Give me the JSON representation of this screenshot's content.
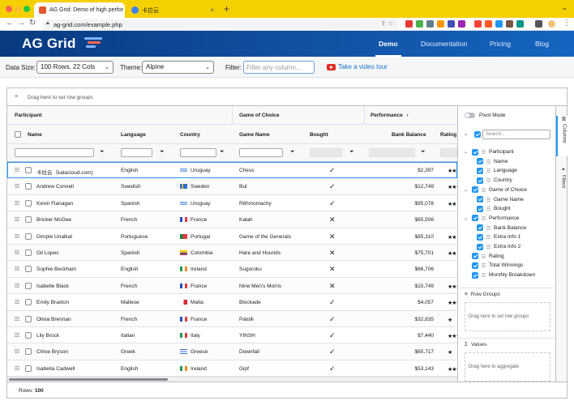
{
  "browser": {
    "tabs": [
      {
        "title": "AG Grid: Demo of high perfor",
        "active": true
      },
      {
        "title": "卡拉云",
        "active": false
      }
    ],
    "new_tab": "+",
    "url": "ag-grid.com/example.php"
  },
  "site": {
    "logo": "AG Grid",
    "nav": [
      "Demo",
      "Documentation",
      "Pricing",
      "Blog"
    ]
  },
  "toolbar": {
    "data_size_label": "Data Size:",
    "data_size_value": "100 Rows, 22 Cols",
    "theme_label": "Theme:",
    "theme_value": "Alpine",
    "filter_label": "Filter:",
    "filter_placeholder": "Filter any column...",
    "video_link": "Take a video tour"
  },
  "grid": {
    "row_group_hint": "Drag here to set row groups",
    "group_headers": {
      "participant": "Participant",
      "game": "Game of Choice",
      "performance": "Performance"
    },
    "columns": {
      "name": "Name",
      "language": "Language",
      "country": "Country",
      "game_name": "Game Name",
      "bought": "Bought",
      "bank_balance": "Bank Balance",
      "rating": "Rating"
    },
    "rows": [
      {
        "name": "卡拉云（kalacloud.com)",
        "language": "English",
        "country": "Uruguay",
        "game": "Chess",
        "bought": true,
        "balance": "$2,397",
        "rating": "★★"
      },
      {
        "name": "Andrew Connell",
        "language": "Swedish",
        "country": "Sweden",
        "game": "Bul",
        "bought": true,
        "balance": "$12,749",
        "rating": "★★★"
      },
      {
        "name": "Kevin Flanagan",
        "language": "Spanish",
        "country": "Uruguay",
        "game": "Rithmomachy",
        "bought": true,
        "balance": "$95,078",
        "rating": "★★"
      },
      {
        "name": "Bricker McGee",
        "language": "French",
        "country": "France",
        "game": "Kalah",
        "bought": false,
        "balance": "$65,506",
        "rating": ""
      },
      {
        "name": "Dimple Unalkat",
        "language": "Portuguese",
        "country": "Portugal",
        "game": "Game of the Generals",
        "bought": false,
        "balance": "$85,310",
        "rating": "★★"
      },
      {
        "name": "Gil Lopes",
        "language": "Spanish",
        "country": "Colombia",
        "game": "Hare and Hounds",
        "bought": false,
        "balance": "$75,701",
        "rating": "★★"
      },
      {
        "name": "Sophie Beckham",
        "language": "English",
        "country": "Ireland",
        "game": "Sugoroku",
        "bought": false,
        "balance": "$66,706",
        "rating": ""
      },
      {
        "name": "Isabelle Black",
        "language": "French",
        "country": "France",
        "game": "Nine Men's Morris",
        "bought": false,
        "balance": "$15,749",
        "rating": "★★★"
      },
      {
        "name": "Emily Braxton",
        "language": "Maltese",
        "country": "Malta",
        "game": "Blockade",
        "bought": true,
        "balance": "$4,057",
        "rating": "★★★"
      },
      {
        "name": "Olivia Brennan",
        "language": "French",
        "country": "France",
        "game": "Patolli",
        "bought": true,
        "balance": "$32,835",
        "rating": "★"
      },
      {
        "name": "Lily Brock",
        "language": "Italian",
        "country": "Italy",
        "game": "YINSH",
        "bought": true,
        "balance": "$7,440",
        "rating": "★★★"
      },
      {
        "name": "Chloe Bryson",
        "language": "Greek",
        "country": "Greece",
        "game": "Downfall",
        "bought": true,
        "balance": "$65,717",
        "rating": "★"
      },
      {
        "name": "Isabella Cadwell",
        "language": "English",
        "country": "Ireland",
        "game": "Gipf",
        "bought": true,
        "balance": "$53,143",
        "rating": "★★★"
      }
    ],
    "status": {
      "label": "Rows:",
      "count": "100"
    }
  },
  "side_panel": {
    "pivot_mode": "Pivot Mode",
    "search_placeholder": "Search...",
    "tree": [
      {
        "label": "Participant",
        "level": 0,
        "group": true
      },
      {
        "label": "Name",
        "level": 1
      },
      {
        "label": "Language",
        "level": 1
      },
      {
        "label": "Country",
        "level": 1
      },
      {
        "label": "Game of Choice",
        "level": 0,
        "group": true
      },
      {
        "label": "Game Name",
        "level": 1
      },
      {
        "label": "Bought",
        "level": 1
      },
      {
        "label": "Performance",
        "level": 0,
        "group": true
      },
      {
        "label": "Bank Balance",
        "level": 1
      },
      {
        "label": "Extra Info 1",
        "level": 1
      },
      {
        "label": "Extra Info 2",
        "level": 1
      },
      {
        "label": "Rating",
        "level": 0
      },
      {
        "label": "Total Winnings",
        "level": 0
      },
      {
        "label": "Monthly Breakdown",
        "level": 0
      }
    ],
    "row_groups_title": "Row Groups",
    "row_groups_hint": "Drag here to set row groups",
    "values_title": "Values",
    "values_hint": "Drag here to aggregate",
    "tabs": [
      "Columns",
      "Filters"
    ]
  },
  "colors": {
    "chrome_tab_bar": "#f5d000",
    "site_header": "#0e4d9b",
    "accent": "#2196f3",
    "link": "#1a73c9"
  }
}
